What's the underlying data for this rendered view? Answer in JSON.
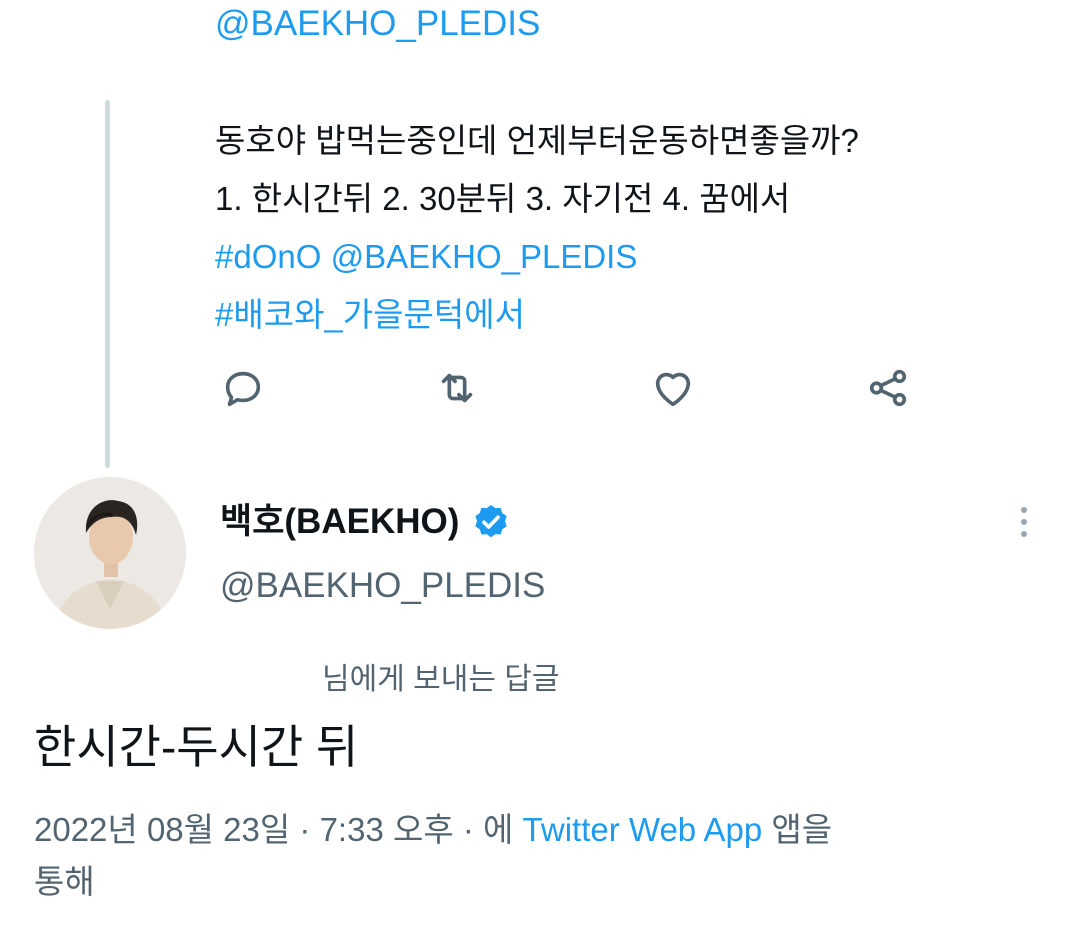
{
  "parent_tweet": {
    "mention_top": "@BAEKHO_PLEDIS",
    "text_line1": "동호야 밥먹는중인데 언제부터운동하면좋을까?",
    "text_line2": "1. 한시간뒤 2. 30분뒤 3. 자기전 4. 꿈에서",
    "hashtag1": "#dOnO",
    "mention": "@BAEKHO_PLEDIS",
    "hashtag2": "#배코와_가을문턱에서",
    "actions": {
      "reply_icon": "reply-icon",
      "retweet_icon": "retweet-icon",
      "like_icon": "heart-icon",
      "share_icon": "share-icon"
    }
  },
  "reply_tweet": {
    "display_name": "백호(BAEKHO)",
    "verified_icon": "verified-badge-icon",
    "handle": "@BAEKHO_PLEDIS",
    "more_icon": "more-vertical-icon",
    "replying_to": "님에게 보내는 답글",
    "text": "한시간-두시간 뒤",
    "timestamp": "2022년 08월 23일 · 7:33 오후 · 에",
    "source_app": "Twitter Web App",
    "source_suffix_1": "앱을",
    "source_suffix_2": "통해"
  },
  "colors": {
    "link": "#1d9bf0",
    "secondary_text": "#536471",
    "thread_line": "#cfd9de",
    "verified": "#1d9bf0"
  }
}
